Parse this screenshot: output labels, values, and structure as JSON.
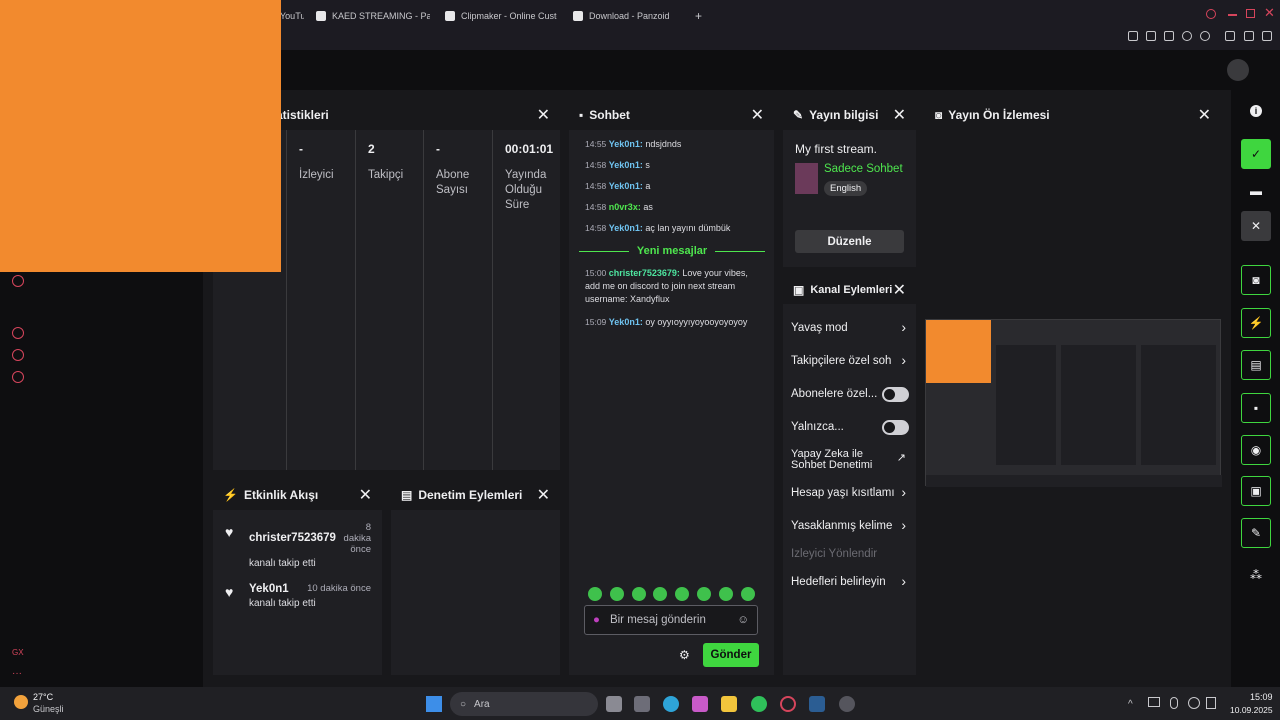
{
  "browser": {
    "tabs": [
      {
        "label": "YouTu"
      },
      {
        "label": "KAED STREAMING - Panz"
      },
      {
        "label": "Clipmaker - Online Custo"
      },
      {
        "label": "Download - Panzoid"
      }
    ],
    "new_tab": "+"
  },
  "stats": {
    "title": "atistikleri",
    "items": [
      {
        "value": "-",
        "label": "İzleyici"
      },
      {
        "value": "2",
        "label": "Takipçi"
      },
      {
        "value": "-",
        "label": "Abone Sayısı"
      },
      {
        "value": "00:01:01",
        "label": "Yayında Olduğu Süre"
      }
    ]
  },
  "chat": {
    "title": "Sohbet",
    "messages": [
      {
        "time": "14:55",
        "user": "Yek0n1:",
        "text": "ndsjdnds",
        "color": "#6fc3f0"
      },
      {
        "time": "14:58",
        "user": "Yek0n1:",
        "text": "s",
        "color": "#6fc3f0"
      },
      {
        "time": "14:58",
        "user": "Yek0n1:",
        "text": "a",
        "color": "#6fc3f0"
      },
      {
        "time": "14:58",
        "user": "n0vr3x:",
        "text": "as",
        "color": "#4ee64e"
      },
      {
        "time": "14:58",
        "user": "Yek0n1:",
        "text": "aç lan yayını dümbük",
        "color": "#6fc3f0"
      }
    ],
    "new_messages": "Yeni mesajlar",
    "new": [
      {
        "time": "15:00",
        "user": "christer7523679:",
        "text": "Love your vibes, add me on discord to join next stream username: Xandyflux",
        "color": "#4ee6a0"
      },
      {
        "time": "15:09",
        "user": "Yek0n1:",
        "text": "oy oyyıoyyıyoyooyoyoyoy",
        "color": "#6fc3f0"
      }
    ],
    "placeholder": "Bir mesaj gönderin",
    "send": "Gönder"
  },
  "info": {
    "title": "Yayın bilgisi",
    "stream_title": "My first stream.",
    "category": "Sadece Sohbet",
    "tag": "English",
    "edit": "Düzenle"
  },
  "preview": {
    "title": "Yayın Ön İzlemesi"
  },
  "actions": {
    "title": "Kanal Eylemleri",
    "items": [
      {
        "label": "Yavaş mod",
        "kind": "chevron"
      },
      {
        "label": "Takipçilere özel soh",
        "kind": "chevron"
      },
      {
        "label": "Abonelere özel...",
        "kind": "toggle"
      },
      {
        "label": "Yalnızca...",
        "kind": "toggle"
      },
      {
        "label": "Yapay Zeka ile Sohbet Denetimi",
        "kind": "external"
      },
      {
        "label": "Hesap yaşı kısıtlamı",
        "kind": "chevron"
      },
      {
        "label": "Yasaklanmış kelime",
        "kind": "chevron"
      },
      {
        "label": "İzleyici Yönlendir",
        "kind": "disabled"
      },
      {
        "label": "Hedefleri belirleyin",
        "kind": "chevron"
      }
    ]
  },
  "activity": {
    "title": "Etkinlik Akışı",
    "events": [
      {
        "user": "christer7523679",
        "action": "kanalı takip etti",
        "time": "8 dakika önce"
      },
      {
        "user": "Yek0n1",
        "action": "kanalı takip etti",
        "time": "10 dakika önce"
      }
    ]
  },
  "moderation": {
    "title": "Denetim Eylemleri"
  },
  "taskbar": {
    "temp": "27°C",
    "weather": "Güneşli",
    "search": "Ara",
    "time": "15:09",
    "date": "10.09.2025"
  },
  "colors": {
    "accent": "#3fd63f",
    "orange": "#f28a2e"
  }
}
